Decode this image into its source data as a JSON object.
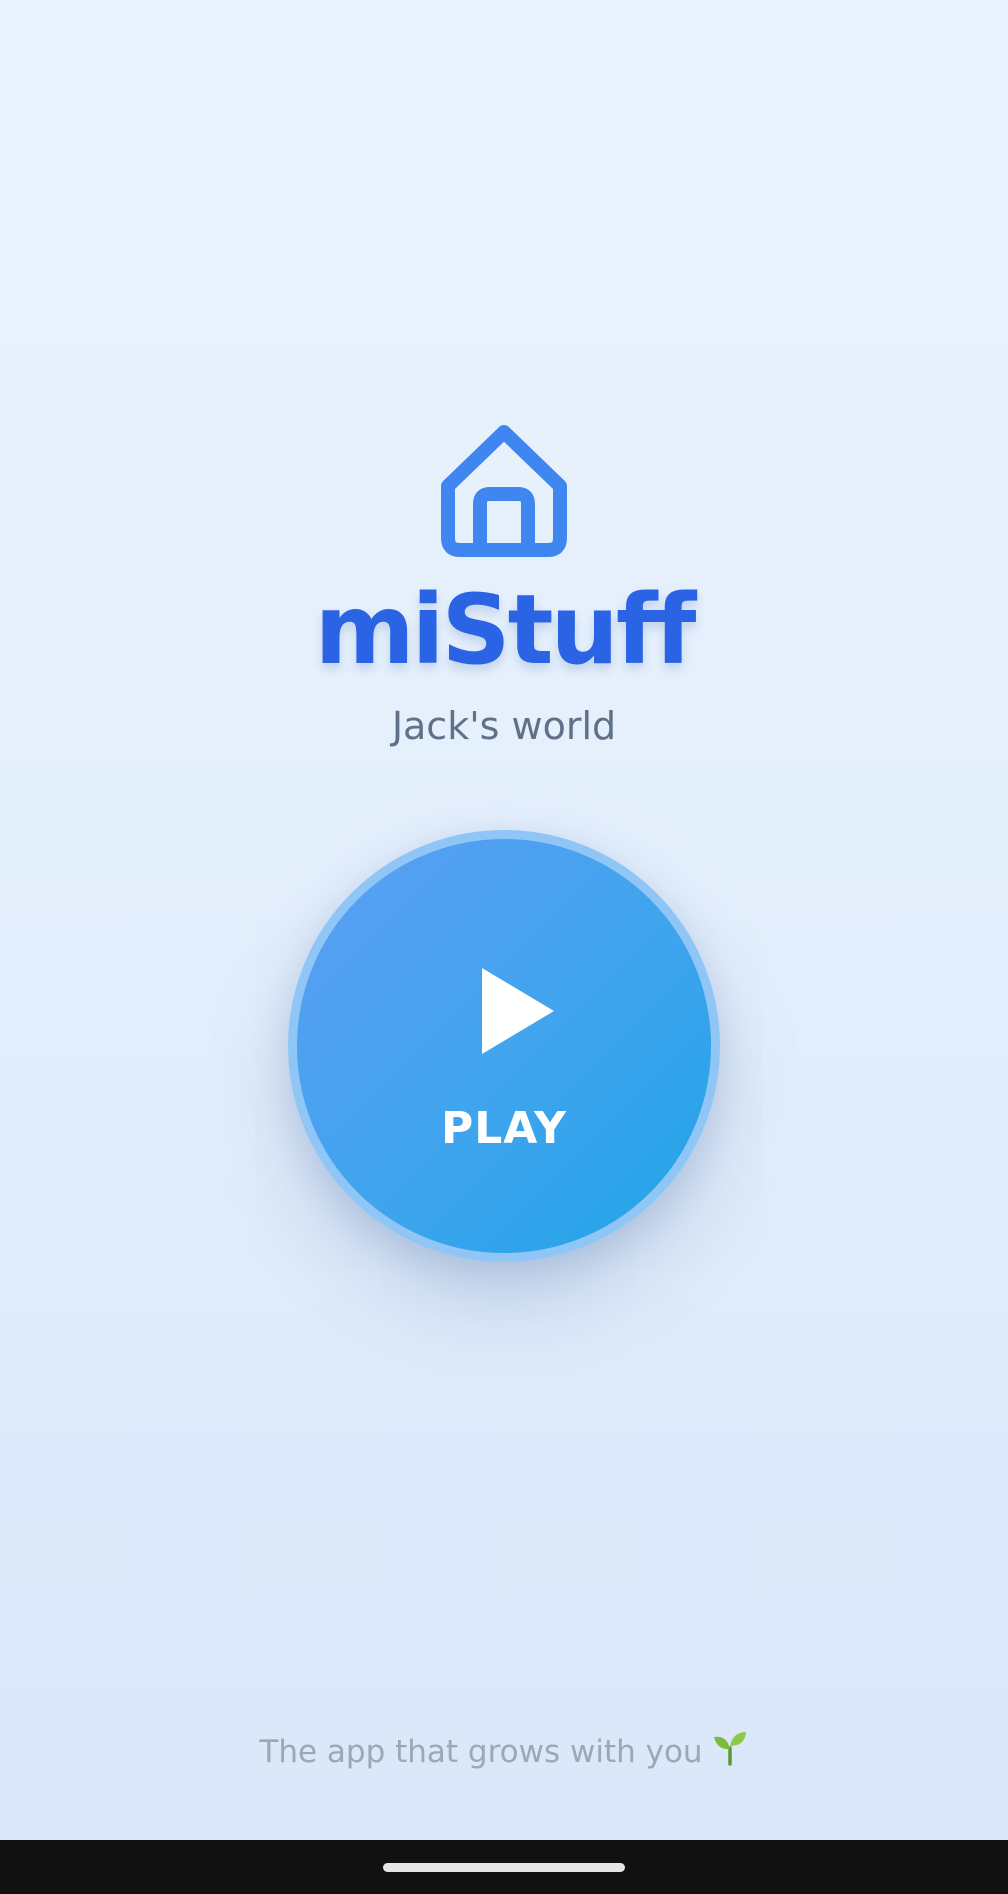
{
  "app": {
    "title": "miStuff",
    "subtitle": "Jack's world"
  },
  "play_button": {
    "label": "PLAY"
  },
  "footer": {
    "tagline": "The app that grows with you"
  },
  "icons": {
    "logo": "house-icon",
    "play": "play-icon",
    "tagline_emoji": "sprout-icon"
  },
  "colors": {
    "brand": "#2a64e4",
    "icon_blue": "#3f86f0",
    "play_gradient_start": "#5c9ef4",
    "play_gradient_end": "#20a4e8",
    "subtitle": "#5f7189",
    "tagline": "#9aa8b8",
    "nav_bar": "#111111"
  }
}
